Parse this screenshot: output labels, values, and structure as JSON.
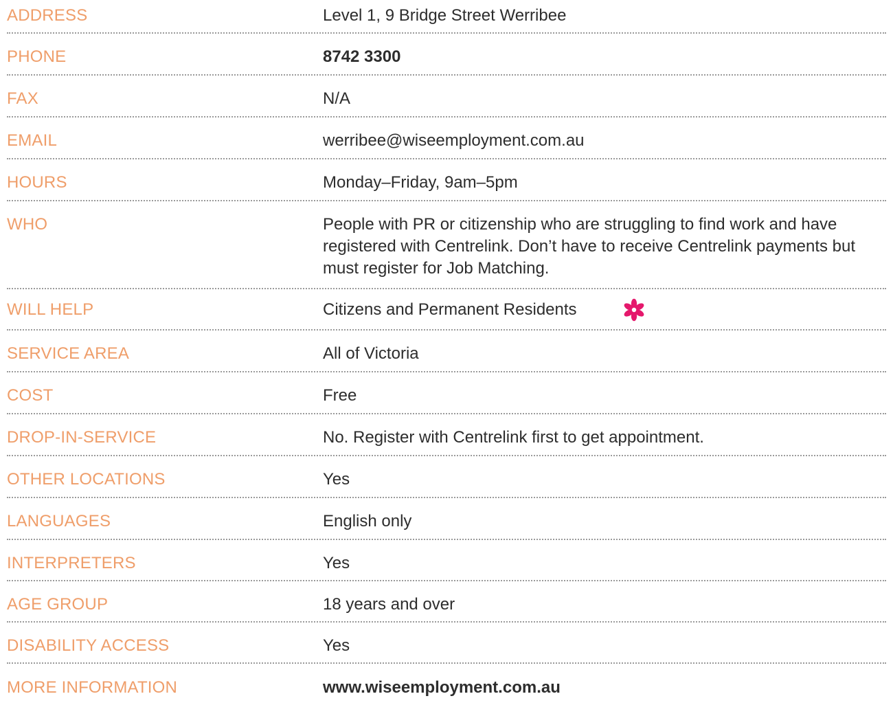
{
  "rows": [
    {
      "label": "ADDRESS",
      "value": "Level 1, 9 Bridge Street Werribee"
    },
    {
      "label": "PHONE",
      "value": "8742 3300"
    },
    {
      "label": "FAX",
      "value": "N/A"
    },
    {
      "label": "EMAIL",
      "value": "werribee@wiseemployment.com.au"
    },
    {
      "label": "HOURS",
      "value": "Monday–Friday, 9am–5pm"
    },
    {
      "label": "WHO",
      "value": "People with PR or citizenship who are struggling to find work and have registered with Centrelink. Don’t have to receive Centrelink payments but must register for Job Matching."
    },
    {
      "label": "WILL HELP",
      "value": "Citizens and Permanent Residents"
    },
    {
      "label": "SERVICE AREA",
      "value": "All of Victoria"
    },
    {
      "label": "COST",
      "value": "Free"
    },
    {
      "label": "DROP-IN-SERVICE",
      "value": "No. Register with Centrelink first to get appointment."
    },
    {
      "label": "OTHER LOCATIONS",
      "value": "Yes"
    },
    {
      "label": "LANGUAGES",
      "value": "English only"
    },
    {
      "label": "INTERPRETERS",
      "value": "Yes"
    },
    {
      "label": "AGE GROUP",
      "value": "18 years and over"
    },
    {
      "label": "DISABILITY ACCESS",
      "value": "Yes"
    },
    {
      "label": "MORE INFORMATION",
      "value": "www.wiseemployment.com.au"
    }
  ],
  "icons": {
    "will_help_marker": "flower-icon"
  },
  "colors": {
    "label": "#ef9e6a",
    "value": "#2d2d2d",
    "accent": "#e5186c",
    "divider": "#9a9a9a"
  }
}
